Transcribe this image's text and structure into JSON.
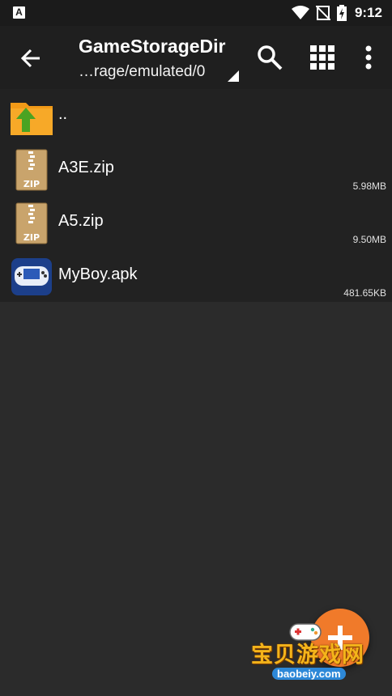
{
  "status_bar": {
    "time": "9:12",
    "notification_icon": "a-icon"
  },
  "toolbar": {
    "title": "GameStorageDir",
    "path": "…rage/emulated/0"
  },
  "files": [
    {
      "name": "..",
      "size": "",
      "icon": "parent-folder-icon"
    },
    {
      "name": "A3E.zip",
      "size": "5.98MB",
      "icon": "zip-archive-icon"
    },
    {
      "name": "A5.zip",
      "size": "9.50MB",
      "icon": "zip-archive-icon"
    },
    {
      "name": "MyBoy.apk",
      "size": "481.65KB",
      "icon": "myboy-app-icon"
    }
  ],
  "fab": {
    "icon": "plus-icon"
  },
  "watermark": {
    "text": "宝贝游戏网",
    "url": "baobeiy.com"
  },
  "colors": {
    "background": "#2b2b2b",
    "toolbar": "#1f1f1f",
    "list": "#222222",
    "fab": "#f07a2a",
    "folder": "#f29a17"
  }
}
